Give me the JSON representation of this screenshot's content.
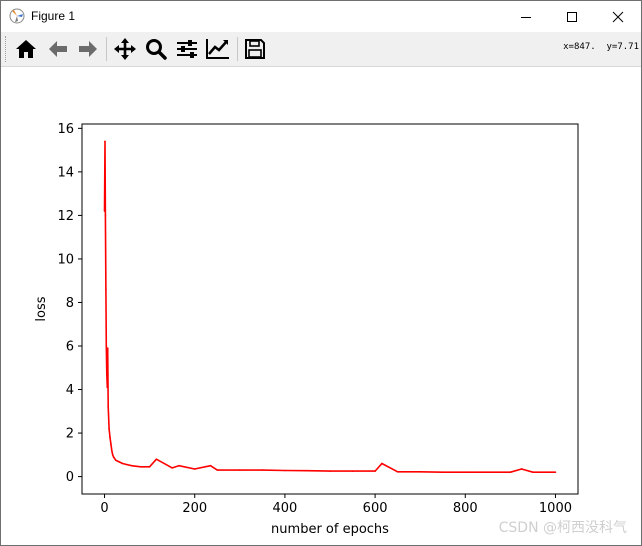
{
  "window": {
    "title": "Figure 1",
    "icon": "matplotlib-icon",
    "controls": [
      "minimize-icon",
      "maximize-icon",
      "close-icon"
    ]
  },
  "toolbar": {
    "buttons": [
      "home-icon",
      "back-arrow-icon",
      "forward-arrow-icon",
      "pan-icon",
      "zoom-icon",
      "subplots-config-icon",
      "edit-axis-icon",
      "save-icon"
    ],
    "coords": "x=847.  y=7.71"
  },
  "chart_data": {
    "type": "line",
    "xlabel": "number of epochs",
    "ylabel": "loss",
    "xlim": [
      -50,
      1050
    ],
    "ylim": [
      -0.8,
      16.2
    ],
    "x_ticks": [
      0,
      200,
      400,
      600,
      800,
      1000
    ],
    "x_tick_labels": [
      "0",
      "200",
      "400",
      "600",
      "800",
      "1000"
    ],
    "y_ticks": [
      0,
      2,
      4,
      6,
      8,
      10,
      12,
      14,
      16
    ],
    "y_tick_labels": [
      "0",
      "2",
      "4",
      "6",
      "8",
      "10",
      "12",
      "14",
      "16"
    ],
    "grid": false,
    "series": [
      {
        "color": "#ff0000",
        "x": [
          0,
          1,
          2,
          3,
          4,
          5,
          6,
          7,
          8,
          10,
          12,
          14,
          16,
          18,
          20,
          25,
          30,
          40,
          50,
          60,
          80,
          100,
          115,
          150,
          165,
          200,
          235,
          250,
          300,
          350,
          400,
          450,
          500,
          550,
          600,
          615,
          650,
          700,
          750,
          800,
          850,
          900,
          925,
          950,
          975,
          1000
        ],
        "y": [
          12.2,
          15.4,
          12.0,
          8.6,
          6.0,
          4.7,
          4.1,
          5.9,
          3.2,
          2.2,
          1.8,
          1.5,
          1.2,
          1.0,
          0.9,
          0.75,
          0.7,
          0.6,
          0.55,
          0.5,
          0.45,
          0.45,
          0.8,
          0.4,
          0.5,
          0.35,
          0.5,
          0.3,
          0.3,
          0.3,
          0.28,
          0.27,
          0.25,
          0.25,
          0.25,
          0.6,
          0.22,
          0.22,
          0.2,
          0.2,
          0.2,
          0.2,
          0.35,
          0.2,
          0.2,
          0.2
        ]
      }
    ]
  },
  "watermark": "CSDN @柯西没科气"
}
